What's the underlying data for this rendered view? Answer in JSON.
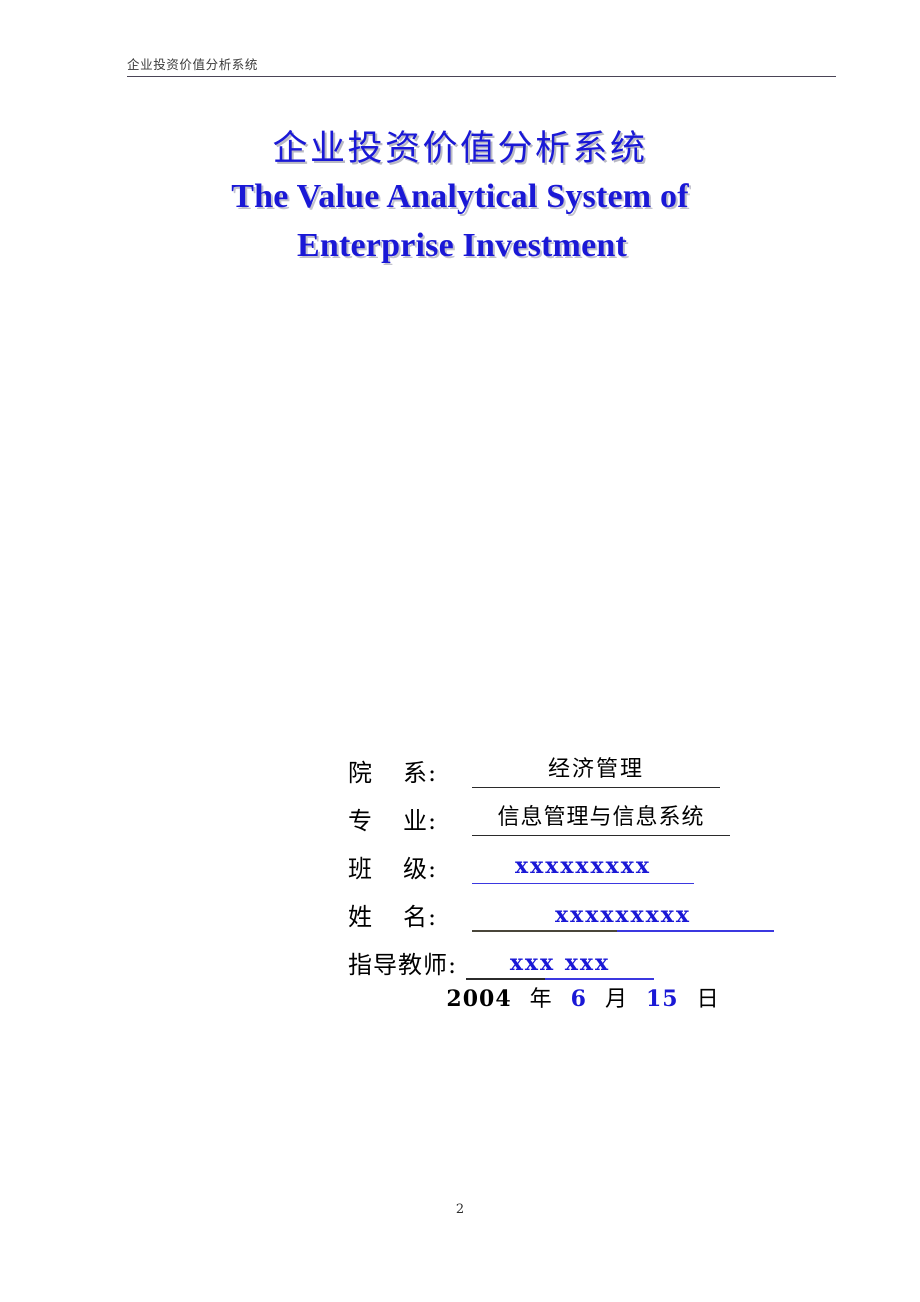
{
  "document": {
    "page_number": "2"
  },
  "header": {
    "running_title": "企业投资价值分析系统"
  },
  "title": {
    "chinese": "企业投资价值分析系统",
    "english_line1": "The Value Analytical System of",
    "english_line2": "Enterprise Investment",
    "color": "#1a18d6",
    "shadow_color": "#b9b9c4"
  },
  "info": {
    "rows": [
      {
        "label_prefix": "院",
        "label_suffix": "系:",
        "value": "经济管理",
        "value_color": "black"
      },
      {
        "label_prefix": "专",
        "label_suffix": "业:",
        "value": "信息管理与信息系统",
        "value_color": "black"
      },
      {
        "label_prefix": "班",
        "label_suffix": "级:",
        "value": "xxxxxxxxx",
        "value_color": "blue"
      },
      {
        "label_prefix": "姓",
        "label_suffix": "名:",
        "value": "xxxxxxxxx",
        "value_color": "blue"
      },
      {
        "label_prefix": "指导教",
        "label_suffix": "师:",
        "value": "xxx xxx",
        "value_color": "blue"
      }
    ]
  },
  "date": {
    "year": "2004",
    "year_unit": "年",
    "month": "6",
    "month_unit": "月",
    "day": "15",
    "day_unit": "日"
  }
}
